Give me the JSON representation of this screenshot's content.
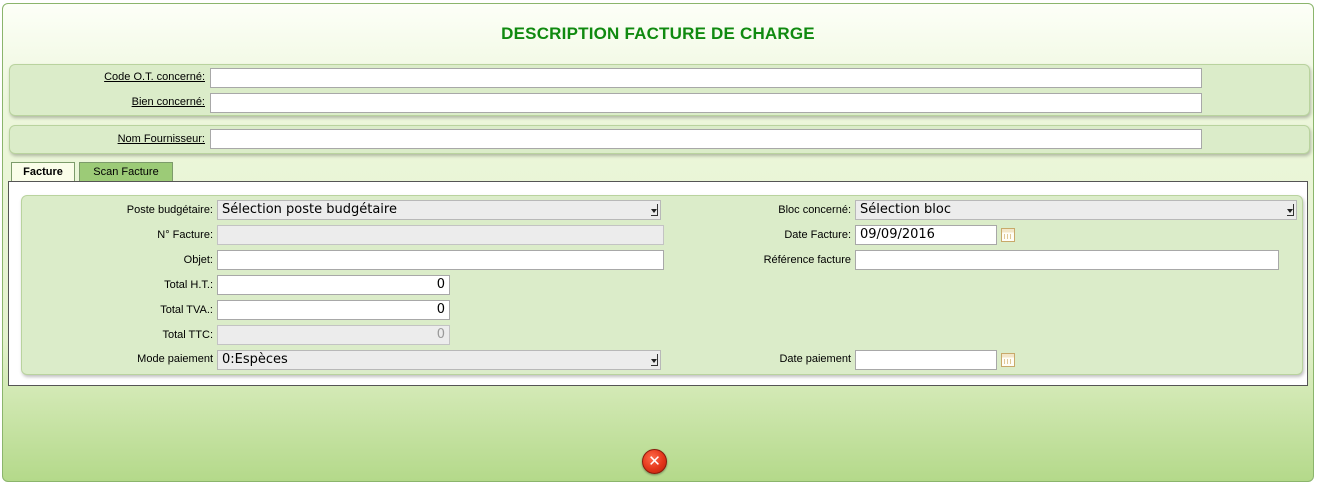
{
  "title": "DESCRIPTION FACTURE DE CHARGE",
  "header_panel": {
    "code_ot_label": "Code O.T. concerné:",
    "code_ot_value": "",
    "bien_label": "Bien concerné:",
    "bien_value": ""
  },
  "supplier_panel": {
    "nom_fournisseur_label": "Nom Fournisseur:",
    "nom_fournisseur_value": ""
  },
  "tabs": [
    {
      "label": "Facture",
      "active": true
    },
    {
      "label": "Scan Facture",
      "active": false
    }
  ],
  "form": {
    "poste_budgetaire_label": "Poste budgétaire:",
    "poste_budgetaire_value": "Sélection poste budgétaire",
    "numero_facture_label": "N° Facture:",
    "numero_facture_value": "",
    "objet_label": "Objet:",
    "objet_value": "",
    "total_ht_label": "Total H.T.:",
    "total_ht_value": "0",
    "total_tva_label": "Total TVA.:",
    "total_tva_value": "0",
    "total_ttc_label": "Total TTC:",
    "total_ttc_value": "0",
    "mode_paiement_label": "Mode paiement",
    "mode_paiement_value": "0:Espèces",
    "bloc_label": "Bloc concerné:",
    "bloc_value": "Sélection bloc",
    "date_facture_label": "Date Facture:",
    "date_facture_value": "09/09/2016",
    "reference_label": "Référence facture",
    "reference_value": "",
    "date_paiement_label": "Date paiement",
    "date_paiement_value": ""
  },
  "icons": {
    "calendar": "calendar-icon",
    "close": "close-icon"
  },
  "colors": {
    "title": "#108a10",
    "panel_bg": "#dbecc9",
    "close_button": "#e3361a"
  }
}
